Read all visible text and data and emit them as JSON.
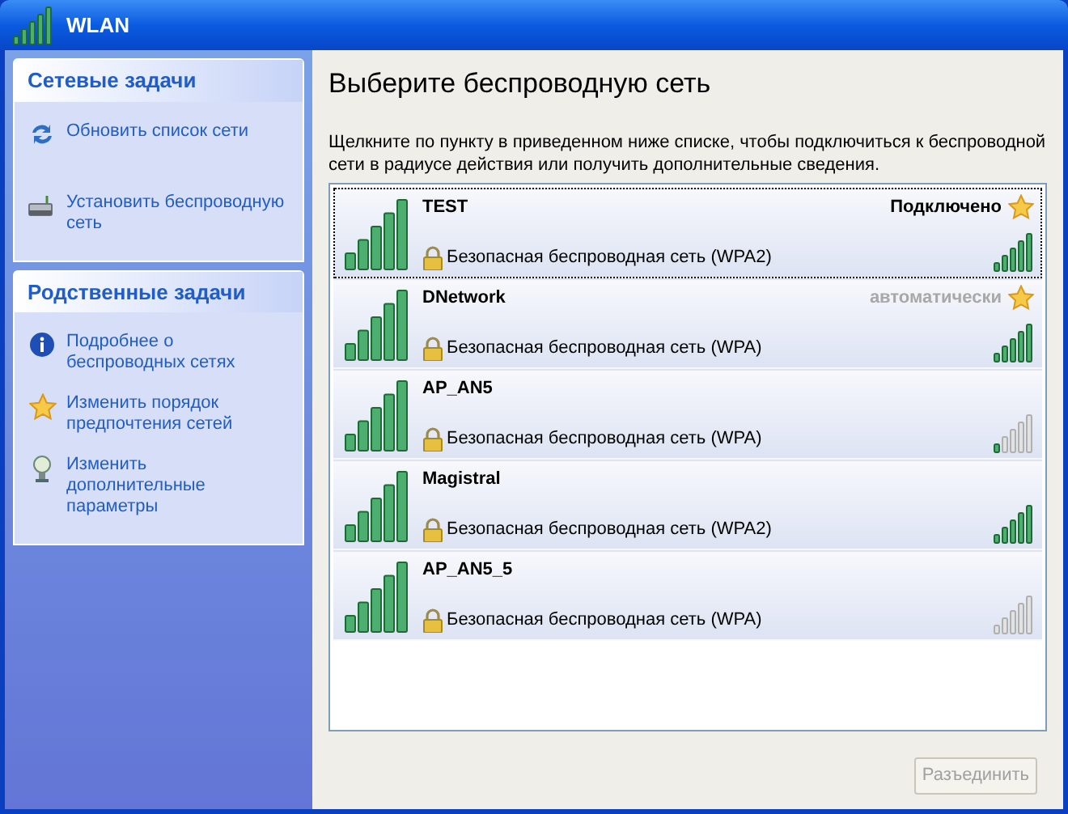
{
  "window": {
    "title": "WLAN"
  },
  "sidebar": {
    "sections": [
      {
        "title": "Сетевые задачи",
        "items": [
          {
            "kind": "refresh",
            "label": "Обновить список сети"
          },
          {
            "kind": "setup",
            "label": "Установить беспроводную сеть"
          }
        ]
      },
      {
        "title": "Родственные задачи",
        "items": [
          {
            "kind": "info",
            "label": "Подробнее о беспроводных сетях"
          },
          {
            "kind": "star",
            "label": "Изменить порядок предпочтения  сетей"
          },
          {
            "kind": "advanced",
            "label": "Изменить дополнительные параметры"
          }
        ]
      }
    ]
  },
  "heading": "Выберите беспроводную сеть",
  "description": "Щелкните по пункту в приведенном ниже списке, чтобы подключиться к беспроводной сети в радиусе действия или получить дополнительные сведения.",
  "networks": [
    {
      "name": "TEST",
      "security": "Безопасная беспроводная сеть (WPA2)",
      "status": {
        "text": "Подключено",
        "connected": true
      },
      "preferred": true,
      "selected": true,
      "kind": "strong"
    },
    {
      "name": "DNetwork",
      "security": "Безопасная беспроводная сеть (WPA)",
      "status": {
        "text": "автоматически",
        "connected": false
      },
      "preferred": true,
      "selected": false,
      "kind": "strong"
    },
    {
      "name": "AP_AN5",
      "security": "Безопасная беспроводная сеть (WPA)",
      "preferred": false,
      "selected": false,
      "kind": "weak"
    },
    {
      "name": "Magistral",
      "security": "Безопасная беспроводная сеть (WPA2)",
      "preferred": false,
      "selected": false,
      "kind": "strong"
    },
    {
      "name": "AP_AN5_5",
      "security": "Безопасная беспроводная сеть (WPA)",
      "preferred": false,
      "selected": false,
      "kind": "unreachable"
    }
  ],
  "disconnect_button": {
    "label": "Разъединить",
    "disabled": true
  }
}
